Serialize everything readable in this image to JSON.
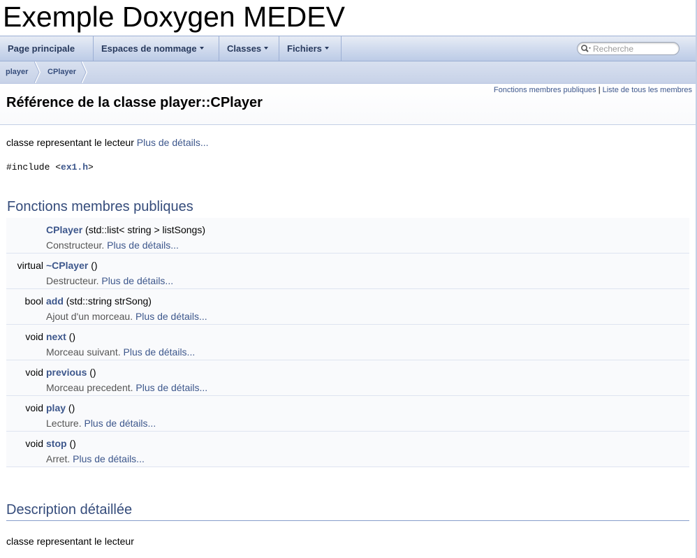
{
  "project": {
    "title": "Exemple Doxygen MEDEV"
  },
  "nav": {
    "items": [
      {
        "label": "Page principale",
        "dropdown": false
      },
      {
        "label": "Espaces de nommage",
        "dropdown": true
      },
      {
        "label": "Classes",
        "dropdown": true
      },
      {
        "label": "Fichiers",
        "dropdown": true
      }
    ],
    "search_placeholder": "Recherche"
  },
  "breadcrumb": {
    "items": [
      "player",
      "CPlayer"
    ]
  },
  "header": {
    "summary_link_1": "Fonctions membres publiques",
    "summary_sep": "|",
    "summary_link_2": "Liste de tous les membres",
    "title": "Référence de la classe player::CPlayer"
  },
  "brief": {
    "text": "classe representant le lecteur",
    "more": "Plus de détails..."
  },
  "include": {
    "prefix": "#include <",
    "file": "ex1.h",
    "suffix": ">"
  },
  "members_section": {
    "title": "Fonctions membres publiques",
    "rows": [
      {
        "type": "",
        "name": "CPlayer",
        "args": " (std::list< string > listSongs)",
        "desc": "Constructeur. ",
        "more": "Plus de détails..."
      },
      {
        "type": "virtual",
        "name": "~CPlayer",
        "args": " ()",
        "desc": "Destructeur. ",
        "more": "Plus de détails..."
      },
      {
        "type": "bool",
        "name": "add",
        "args": " (std::string strSong)",
        "desc": "Ajout d'un morceau. ",
        "more": "Plus de détails..."
      },
      {
        "type": "void",
        "name": "next",
        "args": " ()",
        "desc": "Morceau suivant. ",
        "more": "Plus de détails..."
      },
      {
        "type": "void",
        "name": "previous",
        "args": " ()",
        "desc": "Morceau precedent. ",
        "more": "Plus de détails..."
      },
      {
        "type": "void",
        "name": "play",
        "args": " ()",
        "desc": "Lecture. ",
        "more": "Plus de détails..."
      },
      {
        "type": "void",
        "name": "stop",
        "args": " ()",
        "desc": "Arret. ",
        "more": "Plus de détails..."
      }
    ]
  },
  "detail_section": {
    "title": "Description détaillée",
    "text": "classe representant le lecteur"
  },
  "colors": {
    "link": "#3d578c",
    "heading": "#354c7b",
    "nav_text": "#283a5d"
  }
}
